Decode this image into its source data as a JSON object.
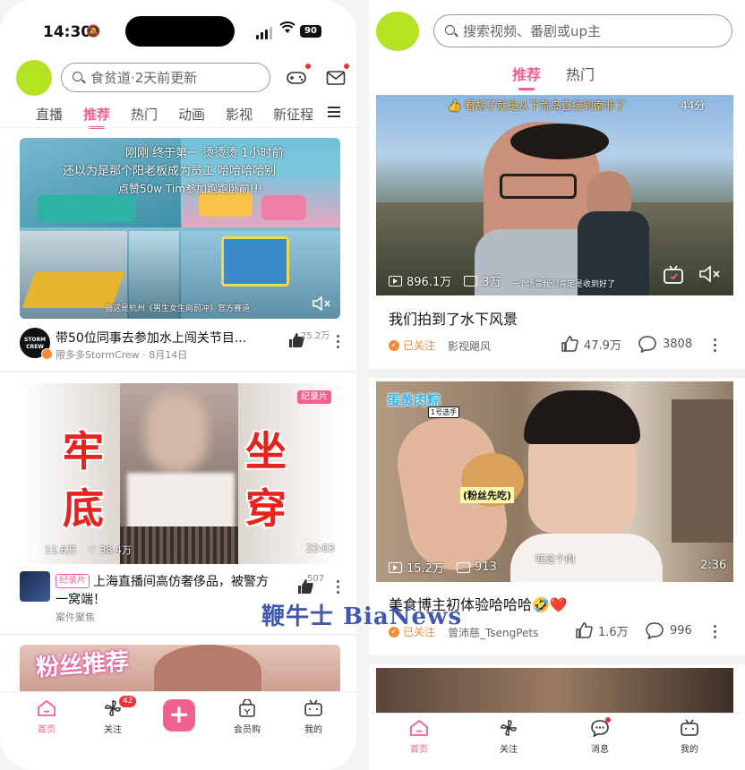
{
  "left": {
    "status": {
      "time": "14:30",
      "battery": "90"
    },
    "search": {
      "placeholder": "食贫道·2天前更新"
    },
    "tabs": [
      "直播",
      "推荐",
      "热门",
      "动画",
      "影视",
      "新征程"
    ],
    "active_tab": "推荐",
    "card1": {
      "overlay_lines": [
        "刚刚  终于第一  烫烫烫    1小时前",
        "还以为是那个阳老板成为员工 哈哈哈哈别",
        "点赞50w Tim参加跑跑卧前!!!"
      ],
      "caption": "画这是杭州《男生女生向前冲》官方赛道",
      "title": "带50位同事去参加水上闯关节目...",
      "channel_logo_text": "STORM CREW",
      "meta": "限多多StormCrew · 8月14日",
      "likes": "25.2万"
    },
    "card2": {
      "badge": "纪录片",
      "left_chars": [
        "牢",
        "底"
      ],
      "right_chars": [
        "坐",
        "穿"
      ],
      "plays": "11.6万",
      "likes_small": "38.4万",
      "duration": "22:03",
      "tag": "纪录片",
      "title": "上海直播间高仿奢侈品，被警方一窝端！",
      "meta": "案件聚焦",
      "likes": "507"
    },
    "card3": {
      "overlay": "粉丝推荐"
    },
    "nav": [
      {
        "label": "首页",
        "icon": "home-icon"
      },
      {
        "label": "关注",
        "icon": "pinwheel-icon",
        "badge": "42"
      },
      {
        "label": "+",
        "icon": "plus-icon"
      },
      {
        "label": "会员购",
        "icon": "shopping-bag-icon"
      },
      {
        "label": "我的",
        "icon": "tv-icon"
      }
    ]
  },
  "right": {
    "search": {
      "placeholder": "搜索视频、番剧或up主"
    },
    "tabs": [
      "推荐",
      "热门"
    ],
    "video1": {
      "top_text": "👍 看胡子就是从下荒岛直接到南非了",
      "top_count": "44分",
      "plays": "896.1万",
      "danmaku": "3万",
      "sub_caption": "一个场景我们肯定是收到好了",
      "title": "我们拍到了水下风景",
      "followed": "已关注",
      "author": "影视飓风",
      "likes": "47.9万",
      "comments": "3808"
    },
    "video2": {
      "sticker_title": "蛋黄肉粽",
      "sticker_sub": "1号选手",
      "center_caption": "(粉丝先吃)",
      "bottom_caption": "哇这个肉",
      "plays": "15.2万",
      "danmaku": "913",
      "duration": "2:36",
      "title": "美食博主初体验哈哈哈🤣❤️",
      "followed": "已关注",
      "author": "曾沛慈_TsengPets",
      "likes": "1.6万",
      "comments": "996"
    },
    "nav": [
      {
        "label": "首页",
        "icon": "home-icon"
      },
      {
        "label": "关注",
        "icon": "pinwheel-icon"
      },
      {
        "label": "消息",
        "icon": "message-icon"
      },
      {
        "label": "我的",
        "icon": "tv-icon"
      }
    ]
  },
  "watermark": "鞭牛士 BiaNews",
  "colors": {
    "accent": "#f2608f",
    "followed": "#f28b33",
    "avatar": "#b3e321"
  }
}
